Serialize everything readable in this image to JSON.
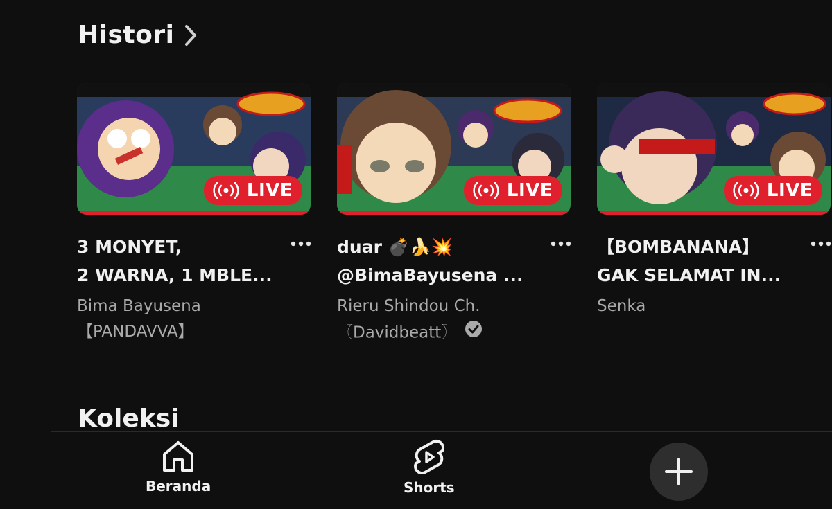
{
  "section": {
    "title": "Histori",
    "next_title": "Koleksi"
  },
  "videos": [
    {
      "title": "3 MONYET,\n2 WARNA, 1 MBLE...",
      "channel": "Bima Bayusena\n【PANDAVVA】",
      "badge": "LIVE",
      "verified": false,
      "thumb_colors": [
        "#3a2a5a",
        "#7a3fb0",
        "#f6d28a"
      ]
    },
    {
      "title": "duar 💣🍌💥\n@BimaBayusena ...",
      "channel": "Rieru Shindou Ch.\n〖Davidbeatt〗",
      "badge": "LIVE",
      "verified": true,
      "thumb_colors": [
        "#2c3a55",
        "#6b4a35",
        "#f4d9b8"
      ]
    },
    {
      "title": "【BOMBANANA】\nGAK SELAMAT IN...",
      "channel": "Senka",
      "badge": "LIVE",
      "verified": false,
      "thumb_colors": [
        "#1e2a44",
        "#4a2a6a",
        "#f1d6c0"
      ]
    }
  ],
  "nav": {
    "home_label": "Beranda",
    "shorts_label": "Shorts",
    "create_icon": "plus-icon"
  },
  "colors": {
    "background": "#0f0f0f",
    "live_red": "#e0202d",
    "secondary_text": "#aaaaaa"
  }
}
